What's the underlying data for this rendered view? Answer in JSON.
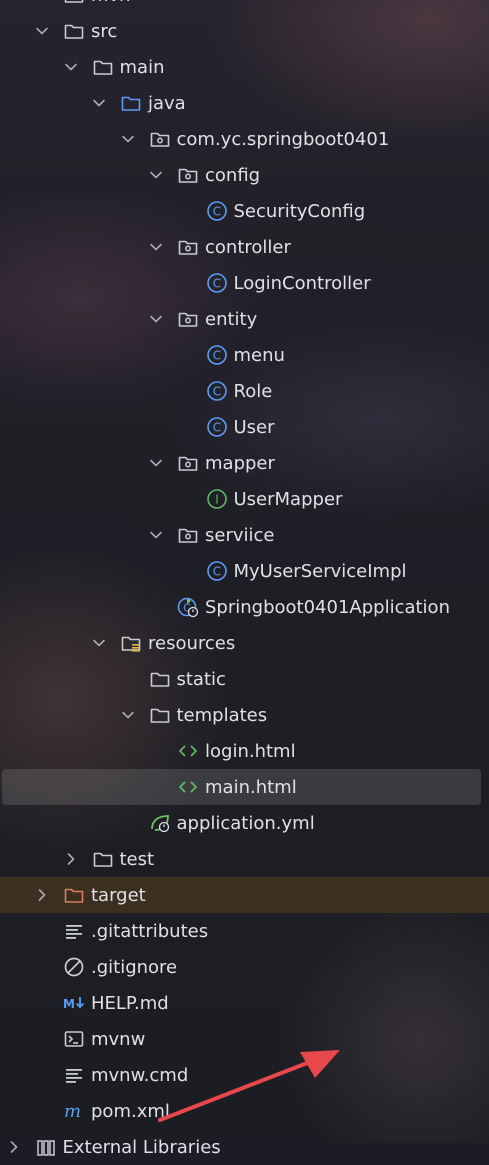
{
  "tree": {
    "items": [
      {
        "label": "mvn",
        "indent": 0,
        "chevron": "none",
        "icon": "folder-icon",
        "state": "partial-top"
      },
      {
        "label": "src",
        "indent": 0,
        "chevron": "down",
        "icon": "folder-icon"
      },
      {
        "label": "main",
        "indent": 1,
        "chevron": "down",
        "icon": "folder-icon"
      },
      {
        "label": "java",
        "indent": 2,
        "chevron": "down",
        "icon": "source-folder-icon"
      },
      {
        "label": "com.yc.springboot0401",
        "indent": 3,
        "chevron": "down",
        "icon": "package-icon"
      },
      {
        "label": "config",
        "indent": 4,
        "chevron": "down",
        "icon": "package-icon"
      },
      {
        "label": "SecurityConfig",
        "indent": 5,
        "chevron": "none",
        "icon": "class-icon"
      },
      {
        "label": "controller",
        "indent": 4,
        "chevron": "down",
        "icon": "package-icon"
      },
      {
        "label": "LoginController",
        "indent": 5,
        "chevron": "none",
        "icon": "class-icon"
      },
      {
        "label": "entity",
        "indent": 4,
        "chevron": "down",
        "icon": "package-icon"
      },
      {
        "label": "menu",
        "indent": 5,
        "chevron": "none",
        "icon": "class-icon"
      },
      {
        "label": "Role",
        "indent": 5,
        "chevron": "none",
        "icon": "class-icon"
      },
      {
        "label": "User",
        "indent": 5,
        "chevron": "none",
        "icon": "class-icon"
      },
      {
        "label": "mapper",
        "indent": 4,
        "chevron": "down",
        "icon": "package-icon"
      },
      {
        "label": "UserMapper",
        "indent": 5,
        "chevron": "none",
        "icon": "interface-icon"
      },
      {
        "label": "serviice",
        "indent": 4,
        "chevron": "down",
        "icon": "package-icon"
      },
      {
        "label": "MyUserServiceImpl",
        "indent": 5,
        "chevron": "none",
        "icon": "class-icon"
      },
      {
        "label": "Springboot0401Application",
        "indent": 4,
        "chevron": "none",
        "icon": "spring-boot-class-icon"
      },
      {
        "label": "resources",
        "indent": 2,
        "chevron": "down",
        "icon": "resources-folder-icon"
      },
      {
        "label": "static",
        "indent": 3,
        "chevron": "none",
        "icon": "folder-icon"
      },
      {
        "label": "templates",
        "indent": 3,
        "chevron": "down",
        "icon": "folder-icon"
      },
      {
        "label": "login.html",
        "indent": 4,
        "chevron": "none",
        "icon": "html-file-icon"
      },
      {
        "label": "main.html",
        "indent": 4,
        "chevron": "none",
        "icon": "html-file-icon",
        "selected": true
      },
      {
        "label": "application.yml",
        "indent": 3,
        "chevron": "none",
        "icon": "spring-yml-icon"
      },
      {
        "label": "test",
        "indent": 1,
        "chevron": "right",
        "icon": "folder-icon"
      },
      {
        "label": "target",
        "indent": 0,
        "chevron": "right",
        "icon": "excluded-folder-icon",
        "highlight": "target"
      },
      {
        "label": ".gitattributes",
        "indent": 0,
        "chevron": "none",
        "icon": "text-file-icon"
      },
      {
        "label": ".gitignore",
        "indent": 0,
        "chevron": "none",
        "icon": "ignore-file-icon"
      },
      {
        "label": "HELP.md",
        "indent": 0,
        "chevron": "none",
        "icon": "markdown-file-icon"
      },
      {
        "label": "mvnw",
        "indent": 0,
        "chevron": "none",
        "icon": "shell-file-icon"
      },
      {
        "label": "mvnw.cmd",
        "indent": 0,
        "chevron": "none",
        "icon": "text-file-icon"
      },
      {
        "label": "pom.xml",
        "indent": 0,
        "chevron": "none",
        "icon": "maven-pom-icon"
      },
      {
        "label": "External Libraries",
        "indent": -1,
        "chevron": "right",
        "icon": "library-icon",
        "state": "partial-bottom"
      }
    ]
  },
  "colors": {
    "text": "#dfe1e5",
    "chevron": "#a8abb0",
    "folder": "#c9ccd1",
    "source_folder": "#5b9cf5",
    "class_blue": "#5b9cf5",
    "interface_green": "#5fb865",
    "html_green": "#5fb865",
    "spring_green": "#6cc36c",
    "excluded_orange": "#d6805d",
    "markdown_blue": "#5b9cf5",
    "arrow_red": "#e8474c"
  }
}
